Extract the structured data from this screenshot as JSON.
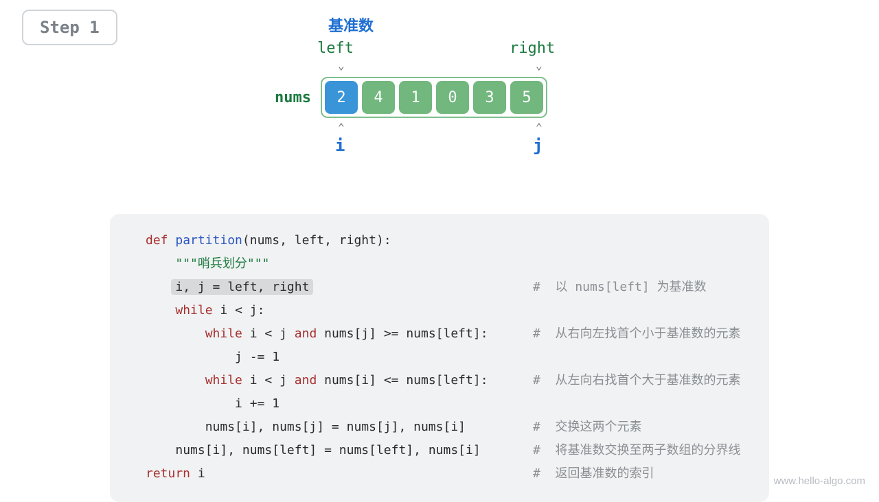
{
  "step": "Step 1",
  "diagram": {
    "pivot_label": "基准数",
    "left_label": "left",
    "right_label": "right",
    "array_label": "nums",
    "cells": [
      "2",
      "4",
      "1",
      "0",
      "3",
      "5"
    ],
    "pivot_index": 0,
    "i_label": "i",
    "j_label": "j"
  },
  "code": {
    "l1": {
      "def": "def ",
      "fn": "partition",
      "sig": "(nums, left, right):"
    },
    "l2": "\"\"\"哨兵划分\"\"\"",
    "l3": "i, j = left, right",
    "l3_cmt": "#  以 nums[left] 为基准数",
    "l4": {
      "kw": "while ",
      "rest": "i < j:"
    },
    "l5": {
      "kw": "while ",
      "rest": "i < j ",
      "and": "and",
      "rest2": " nums[j] >= nums[left]:"
    },
    "l5_cmt": "#  从右向左找首个小于基准数的元素",
    "l6": "j -= 1",
    "l7": {
      "kw": "while ",
      "rest": "i < j ",
      "and": "and",
      "rest2": " nums[i] <= nums[left]:"
    },
    "l7_cmt": "#  从左向右找首个大于基准数的元素",
    "l8": "i += 1",
    "l9": "nums[i], nums[j] = nums[j], nums[i]",
    "l9_cmt": "#  交换这两个元素",
    "l10": "nums[i], nums[left] = nums[left], nums[i]",
    "l10_cmt": "#  将基准数交换至两子数组的分界线",
    "l11": {
      "kw": "return ",
      "rest": "i"
    },
    "l11_cmt": "#  返回基准数的索引"
  },
  "footer": "www.hello-algo.com"
}
